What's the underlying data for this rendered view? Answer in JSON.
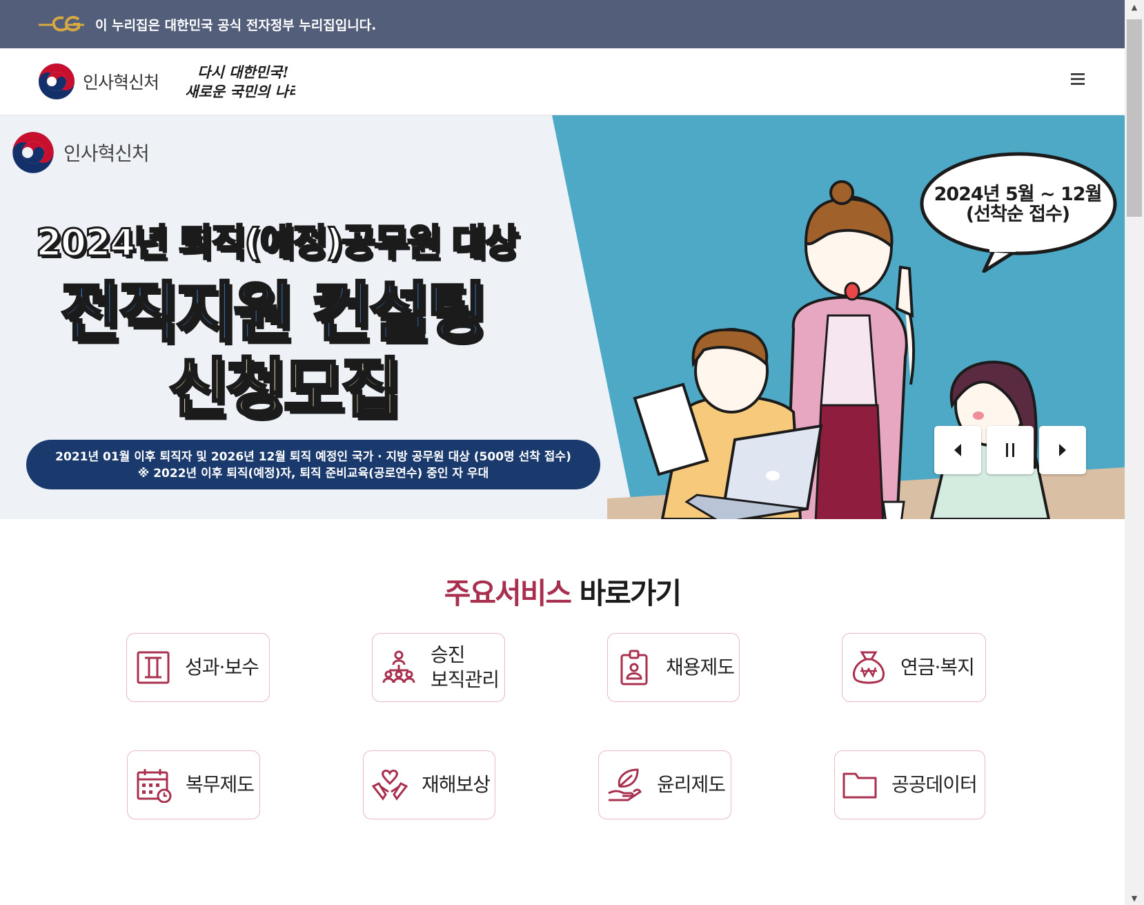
{
  "gov_banner": {
    "text": "이 누리집은 대한민국 공식 전자정부 누리집입니다."
  },
  "header": {
    "ministry_name": "인사혁신처",
    "slogan_line1": "다시 대한민국!",
    "slogan_line2": "새로운 국민의 나라"
  },
  "hero": {
    "logo_text": "인사혁신처",
    "line1": "2024년 퇴직(예정)공무원 대상",
    "line2": "전직지원 컨설팅",
    "line3": "신청모집",
    "pill_line1": "2021년 01월 이후 퇴직자 및 2026년 12월 퇴직 예정인 국가 · 지방 공무원 대상 (500명 선착 접수)",
    "pill_line2": "※ 2022년 이후 퇴직(예정)자, 퇴직 준비교육(공로연수) 중인 자 우대",
    "bubble_line1": "2024년 5월 ~ 12월",
    "bubble_line2": "(선착순 접수)"
  },
  "services": {
    "title_accent": "주요서비스",
    "title_rest": " 바로가기",
    "items": [
      {
        "label": "성과·보수",
        "icon": "document-icon"
      },
      {
        "label": "승진\n보직관리",
        "icon": "org-chart-icon"
      },
      {
        "label": "채용제도",
        "icon": "id-card-icon"
      },
      {
        "label": "연금·복지",
        "icon": "money-bag-icon"
      },
      {
        "label": "복무제도",
        "icon": "calendar-clock-icon"
      },
      {
        "label": "재해보상",
        "icon": "heart-hands-icon"
      },
      {
        "label": "윤리제도",
        "icon": "leaf-hand-icon"
      },
      {
        "label": "공공데이터",
        "icon": "folder-icon"
      }
    ]
  },
  "colors": {
    "accent": "#a8304e",
    "banner": "#535f7a",
    "navy": "#1a3a6e",
    "teal": "#4ea9c6"
  }
}
